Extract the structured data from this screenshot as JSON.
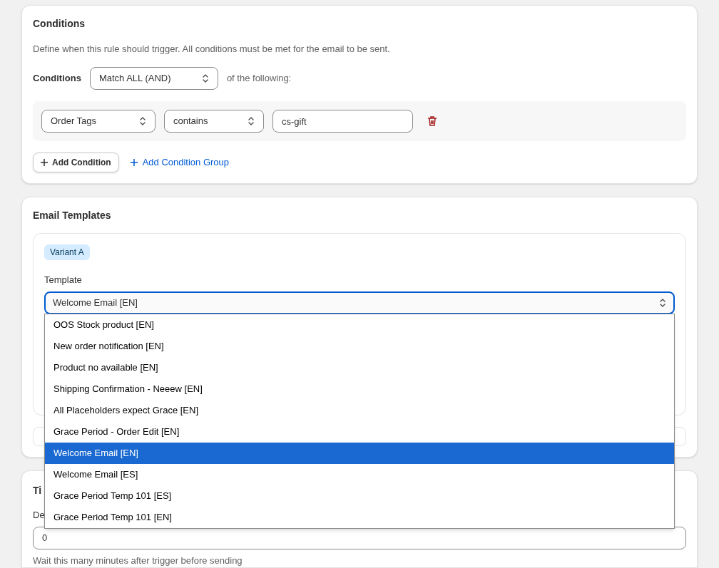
{
  "conditions": {
    "title": "Conditions",
    "description": "Define when this rule should trigger. All conditions must be met for the email to be sent.",
    "match_label": "Conditions",
    "match_select": "Match ALL (AND)",
    "match_suffix": "of the following:",
    "rows": [
      {
        "field": "Order Tags",
        "operator": "contains",
        "value": "cs-gift"
      }
    ],
    "add_condition": "Add Condition",
    "add_group": "Add Condition Group"
  },
  "email_templates": {
    "title": "Email Templates",
    "variant_badge": "Variant A",
    "template_label": "Template",
    "template_value": "Welcome Email [EN]",
    "options": [
      {
        "label": "OOS Stock product [EN]",
        "selected": false
      },
      {
        "label": "New order notification [EN]",
        "selected": false
      },
      {
        "label": "Product no available [EN]",
        "selected": false
      },
      {
        "label": "Shipping Confirmation - Neeew [EN]",
        "selected": false
      },
      {
        "label": "All Placeholders expect Grace [EN]",
        "selected": false
      },
      {
        "label": "Grace Period - Order Edit [EN]",
        "selected": false
      },
      {
        "label": "Welcome Email [EN]",
        "selected": true
      },
      {
        "label": "Welcome Email [ES]",
        "selected": false
      },
      {
        "label": "Grace Period Temp 101 [ES]",
        "selected": false
      },
      {
        "label": "Grace Period Temp 101 [EN]",
        "selected": false
      }
    ]
  },
  "timing": {
    "title": "Ti",
    "delay_label": "De",
    "delay_value": "0",
    "help": "Wait this many minutes after trigger before sending"
  }
}
